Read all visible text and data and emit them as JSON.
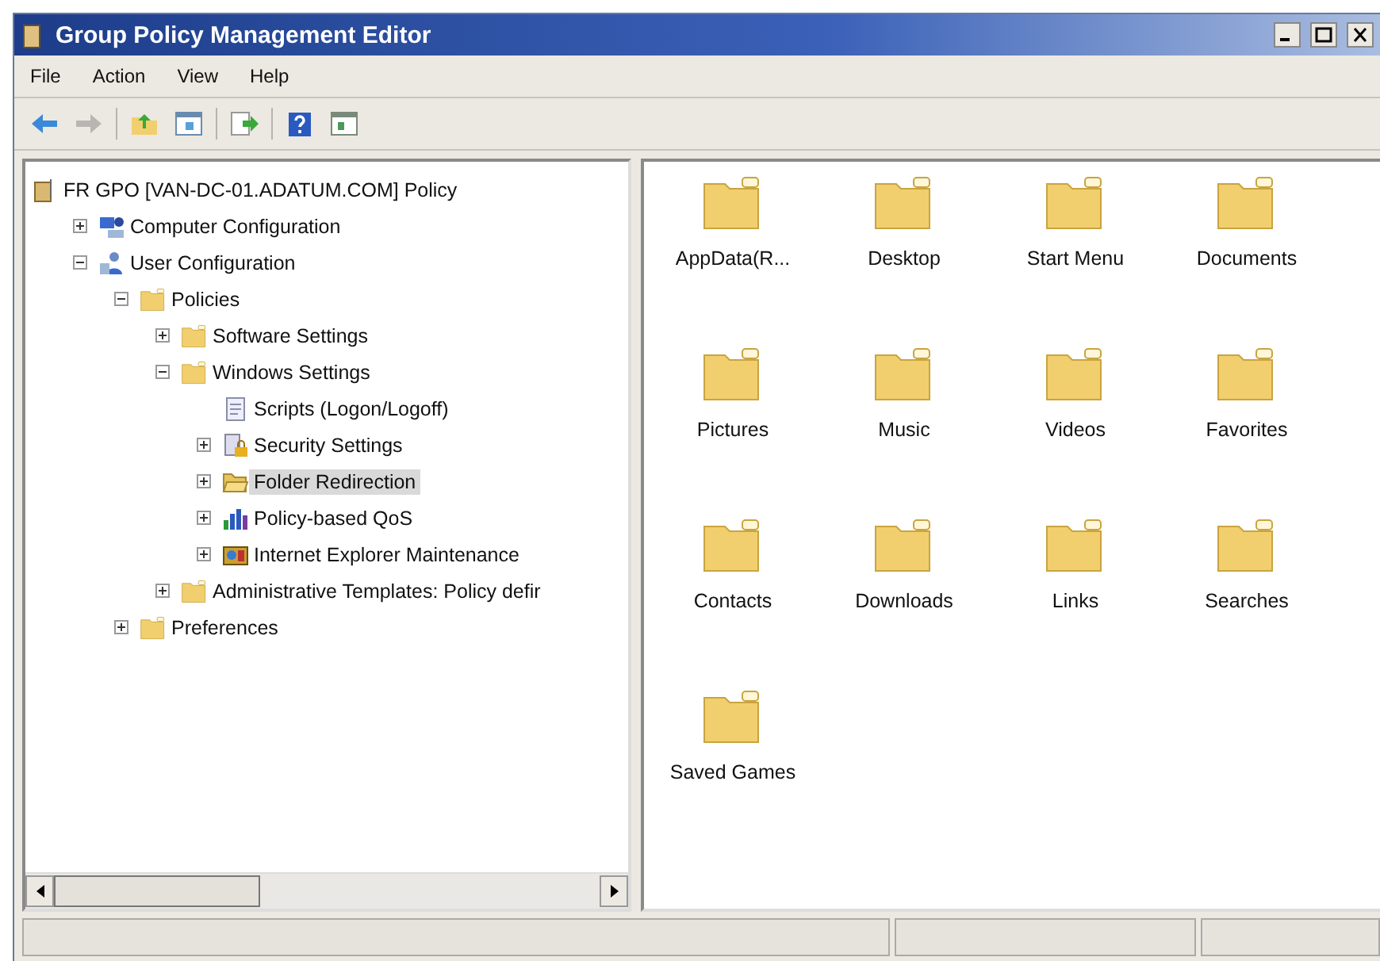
{
  "window": {
    "title": "Group Policy Management Editor"
  },
  "menu": [
    "File",
    "Action",
    "View",
    "Help"
  ],
  "toolbar": [
    {
      "kind": "back",
      "disabled": false
    },
    {
      "kind": "forward",
      "disabled": true
    },
    {
      "kind": "separator"
    },
    {
      "kind": "up",
      "disabled": false
    },
    {
      "kind": "tree",
      "disabled": false
    },
    {
      "kind": "separator"
    },
    {
      "kind": "export",
      "disabled": false
    },
    {
      "kind": "separator"
    },
    {
      "kind": "help",
      "disabled": false
    },
    {
      "kind": "pane",
      "disabled": false
    }
  ],
  "tree": [
    {
      "label": "FR GPO [VAN-DC-01.ADATUM.COM] Policy",
      "kind": "policy",
      "selected": false,
      "children": [
        {
          "label": "Computer Configuration",
          "kind": "computer",
          "expanded": false,
          "selected": false
        },
        {
          "label": "User Configuration",
          "kind": "user",
          "expanded": true,
          "selected": false,
          "children": [
            {
              "label": "Policies",
              "kind": "folder",
              "expanded": true,
              "selected": false,
              "children": [
                {
                  "label": "Software Settings",
                  "kind": "folder",
                  "expanded": false,
                  "selected": false
                },
                {
                  "label": "Windows Settings",
                  "kind": "folder",
                  "expanded": true,
                  "selected": false,
                  "children": [
                    {
                      "label": "Scripts (Logon/Logoff)",
                      "kind": "script",
                      "selected": false
                    },
                    {
                      "label": "Security Settings",
                      "kind": "security",
                      "expanded": false,
                      "selected": false
                    },
                    {
                      "label": "Folder Redirection",
                      "kind": "openfolder",
                      "expanded": false,
                      "selected": true
                    },
                    {
                      "label": "Policy-based QoS",
                      "kind": "chart",
                      "expanded": false,
                      "selected": false
                    },
                    {
                      "label": "Internet Explorer Maintenance",
                      "kind": "ie",
                      "expanded": false,
                      "selected": false
                    }
                  ]
                },
                {
                  "label": "Administrative Templates: Policy defir",
                  "kind": "folder",
                  "expanded": false,
                  "selected": false
                }
              ]
            },
            {
              "label": "Preferences",
              "kind": "folder",
              "expanded": false,
              "selected": false
            }
          ]
        }
      ]
    }
  ],
  "folders": [
    "AppData(R...",
    "Desktop",
    "Start Menu",
    "Documents",
    "Pictures",
    "Music",
    "Videos",
    "Favorites",
    "Contacts",
    "Downloads",
    "Links",
    "Searches",
    "Saved Games"
  ]
}
